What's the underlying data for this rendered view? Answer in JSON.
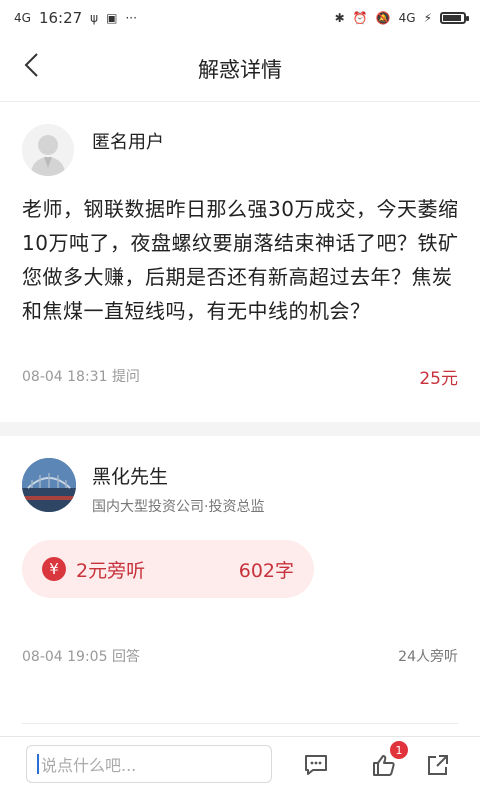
{
  "status_bar": {
    "network": "4G",
    "time": "16:27",
    "more": "···",
    "signal_right": "4G"
  },
  "nav": {
    "title": "解惑详情"
  },
  "question": {
    "asker": "匿名用户",
    "text": "老师，钢联数据昨日那么强30万成交，今天萎缩10万吨了，夜盘螺纹要崩落结束神话了吧？铁矿您做多大赚，后期是否还有新高超过去年？焦炭和焦煤一直短线吗，有无中线的机会？",
    "time": "08-04 18:31",
    "action": "提问",
    "price": "25元"
  },
  "answer": {
    "expert_name": "黑化先生",
    "expert_title": "国内大型投资公司·投资总监",
    "listen_label": "2元旁听",
    "word_count": "602字",
    "time": "08-04 19:05",
    "action": "回答",
    "listeners": "24人旁听"
  },
  "bottom_bar": {
    "input_placeholder": "说点什么吧...",
    "like_badge": "1"
  },
  "colors": {
    "accent_red": "#c8323c",
    "pill_bg": "#fdeceb"
  }
}
